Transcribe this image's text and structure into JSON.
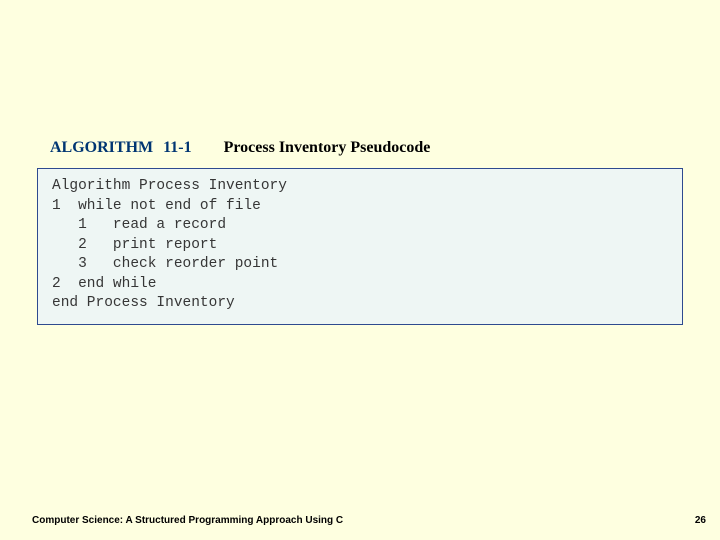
{
  "heading": {
    "label": "ALGORITHM",
    "number": "11-1",
    "title": "Process Inventory Pseudocode"
  },
  "code": {
    "lines": [
      "Algorithm Process Inventory",
      "1  while not end of file",
      "   1   read a record",
      "   2   print report",
      "   3   check reorder point",
      "2  end while",
      "end Process Inventory"
    ]
  },
  "footer": {
    "text": "Computer Science: A Structured Programming Approach Using C",
    "page": "26"
  }
}
